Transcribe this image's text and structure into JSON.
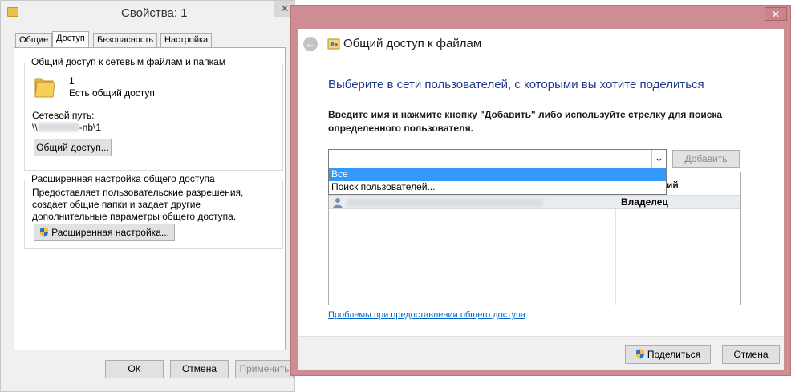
{
  "props_window": {
    "title": "Свойства: 1",
    "close_glyph": "✕",
    "tabs": [
      "Общие",
      "Доступ",
      "Безопасность",
      "Настройка"
    ],
    "active_tab": "Доступ",
    "network_group": {
      "label": "Общий доступ к сетевым файлам и папкам",
      "folder_name": "1",
      "status": "Есть общий доступ",
      "path_label": "Сетевой путь:",
      "path_prefix": "\\\\",
      "path_suffix": "-nb\\1",
      "share_button": "Общий доступ..."
    },
    "advanced_group": {
      "label": "Расширенная настройка общего доступа",
      "description": "Предоставляет пользовательские разрешения, создает общие папки и задает другие дополнительные параметры общего доступа.",
      "button": "Расширенная настройка..."
    },
    "buttons": {
      "ok": "ОК",
      "cancel": "Отмена",
      "apply": "Применить"
    }
  },
  "share_dialog": {
    "close_glyph": "✕",
    "back_glyph": "←",
    "title": "Общий доступ к файлам",
    "heading": "Выберите в сети пользователей, с которыми вы хотите поделиться",
    "instruction": "Введите имя и нажмите кнопку \"Добавить\" либо используйте стрелку для поиска определенного пользователя.",
    "combo_value": "",
    "combo_arrow": "⌄",
    "add_button": "Добавить",
    "dropdown_items": [
      "Все",
      "Поиск пользователей..."
    ],
    "column_permissions": "разрешений",
    "rows": [
      {
        "permission": "Владелец"
      }
    ],
    "help_link": "Проблемы при предоставлении общего доступа",
    "share_button": "Поделиться",
    "cancel_button": "Отмена"
  },
  "colors": {
    "dialog_frame": "#cd8d93",
    "heading": "#1e3a8a",
    "selection": "#3399ff",
    "link": "#0066cc"
  },
  "icons": [
    "folder-icon",
    "shield-icon",
    "back-arrow-icon",
    "share-app-icon",
    "user-icon",
    "close-icon"
  ]
}
